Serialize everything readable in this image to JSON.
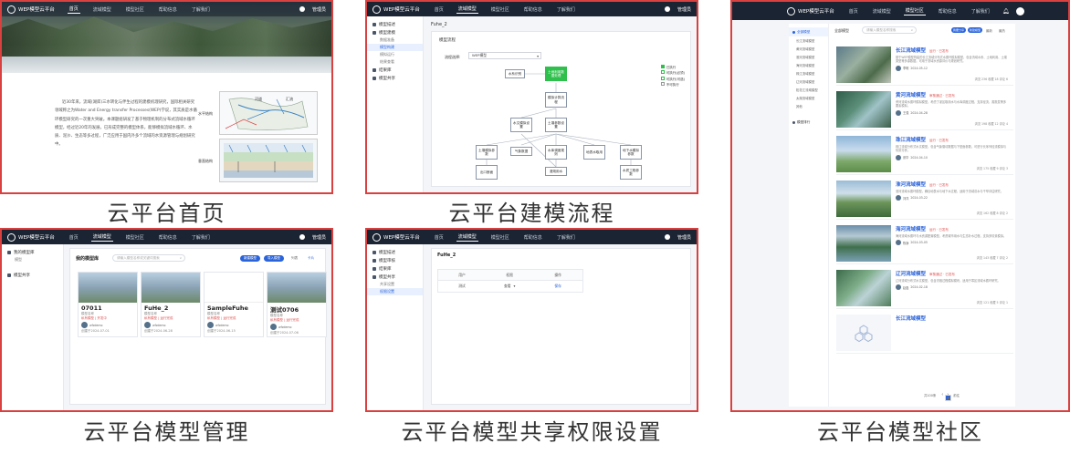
{
  "captions": {
    "p1": "云平台首页",
    "p2": "云平台建模流程",
    "p3": "云平台模型管理",
    "p4": "云平台模型共享权限设置",
    "p5": "云平台模型社区"
  },
  "nav": {
    "logo": "WEP模型云平台",
    "logo_sub": "WEP model cloud platform",
    "items": [
      "首页",
      "流域模型",
      "模型社区",
      "帮助信息",
      "了解我们"
    ],
    "user": "管理员"
  },
  "home": {
    "intro": "近30年来，流域(湖库)三水转化与伴生过程的建模机理研究，国际相关研究领域称之为Water and Energy transfer Processes(WEP)学说，其实质是水循环模型研究的一次重大突破。本课题组研发了基于物理机制的分布式流域水循环模型，经过近20年的发展，已形成完整的模型体系，能够模拟流域水循环、水质、泥沙、生态等多过程，广泛应用于国内外多个流域的水资源管理与规划研究中。",
    "label_a": "水平结构",
    "label_b": "垂直结构",
    "map_label_a": "河道",
    "map_label_b": "汇流"
  },
  "flow": {
    "project": "Fuhe_2",
    "side": {
      "group1": "模型描述",
      "group2": "模型建模",
      "subs": [
        "数据准备",
        "模型构建",
        "模拟运行",
        "结果查看"
      ],
      "group3": "结果库",
      "group4": "模型共享"
    },
    "toolbar_title": "模型流程",
    "select_label": "流程选择:",
    "select_value": "WEP模型",
    "legend": [
      "已执行",
      "可执行(必须)",
      "可执行(可选)",
      "不可执行"
    ],
    "nodes": {
      "n1": "水系识别",
      "n2": "土地利用数据处理",
      "n3": "模拟计算流程",
      "n4": "水文模拟设置",
      "n5": "土壤参数设置",
      "n6": "土壤模拟参数",
      "n7": "气象数据",
      "n8": "水库调度规则",
      "n9": "地表水取用",
      "n10": "地下水模拟参数",
      "n11": "出口断面",
      "n12": "灌溉用水",
      "n13": "水质工程参数"
    }
  },
  "manage": {
    "side_items": [
      "我的模型库",
      "模型",
      "模型共享"
    ],
    "title": "我的模型库",
    "search_placeholder": "请输入模型名称或关键词搜索",
    "btn_new": "新建模型",
    "btn_import": "导入模型",
    "view_list": "列表",
    "view_card": "卡片",
    "cards": [
      {
        "name": "07011",
        "sub": "模型名称",
        "tag": "私有模型 | 开发中",
        "author": "wfzdemo",
        "time": "创建于2024-07-01"
      },
      {
        "name": "FuHe_2",
        "sub": "模型名称",
        "tag": "私有模型 | 运行完成",
        "author": "wfzdemo",
        "time": "创建于2024-06-28"
      },
      {
        "name": "SampleFuhe",
        "sub": "模型名称",
        "tag": "私有模型 | 运行完成",
        "author": "wfzdemo",
        "time": "创建于2024-06-15"
      },
      {
        "name": "测试0706",
        "sub": "模型名称",
        "tag": "私有模型 | 运行完成",
        "author": "wfzdemo",
        "time": "创建于2024-07-06"
      }
    ]
  },
  "share": {
    "project": "FuHe_2",
    "side": {
      "group1": "模型描述",
      "group2": "模型审核",
      "group3": "结果库",
      "group4": "模型共享",
      "subs": [
        "共享设置",
        "权限设置"
      ]
    },
    "table_head": [
      "用户",
      "权限",
      "操作"
    ],
    "row": [
      "测试",
      "查看",
      "保存"
    ]
  },
  "community": {
    "side_title": "全部模型",
    "side_items": [
      "长江流域模型",
      "黄河流域模型",
      "淮河流域模型",
      "海河流域模型",
      "珠江流域模型",
      "辽河流域模型",
      "松花江流域模型",
      "太湖流域模型",
      "其他"
    ],
    "side_bottom": "模型排行",
    "search_placeholder": "请输入模型名称搜索",
    "btn_share": "我要分享",
    "btn_new": "新建模型",
    "sort_a": "最新",
    "sort_b": "最热",
    "items": [
      {
        "title": "长江流域模型",
        "badge": "运行 · 已发布",
        "desc": "基于WEP模型构建的长江流域分布式水循环模拟模型，包含流域水系、土地利用、土壤类型等多源数据，可用于流域水资源评价与规划研究。",
        "author": "李明",
        "time": "2024-05-12",
        "stats": "浏览 236  收藏 18  评论 6"
      },
      {
        "title": "黄河流域模型",
        "badge": "审核通过 · 已发布",
        "desc": "黄河流域水循环模拟模型，考虑了灌区取用水与水库调度过程，支持径流、蒸散发等多要素模拟。",
        "author": "王强",
        "time": "2024-04-28",
        "stats": "浏览 198  收藏 12  评论 4"
      },
      {
        "title": "珠江流域模型",
        "badge": "运行 · 已发布",
        "desc": "珠江流域分布式水文模型，包含气象驱动数据与下垫面参数，可进行长序列径流模拟与情景分析。",
        "author": "张华",
        "time": "2024-04-10",
        "stats": "浏览 175  收藏 9  评论 3"
      },
      {
        "title": "淮河流域模型",
        "badge": "运行 · 已发布",
        "desc": "淮河流域水循环模型，耦合地表水与地下水过程，适用于流域洪水与干旱评估研究。",
        "author": "刘洋",
        "time": "2024-03-22",
        "stats": "浏览 162  收藏 8  评论 2"
      },
      {
        "title": "海河流域模型",
        "badge": "运行 · 已发布",
        "desc": "海河流域水循环与水资源配置模型，考虑城市用水与生态补水过程，支持多情景模拟。",
        "author": "陈静",
        "time": "2024-03-05",
        "stats": "浏览 143  收藏 7  评论 2"
      },
      {
        "title": "辽河流域模型",
        "badge": "审核通过 · 已发布",
        "desc": "辽河流域分布式水文模型，包含冻融过程模拟模块，适用于寒区流域水循环研究。",
        "author": "赵磊",
        "time": "2024-02-18",
        "stats": "浏览 121  收藏 5  评论 1"
      },
      {
        "title": "长江流域模型",
        "badge": "",
        "desc": "",
        "author": "",
        "time": "",
        "stats": ""
      }
    ],
    "pager": {
      "total": "共100条",
      "pages": [
        "1",
        "2",
        "3",
        "4",
        "5",
        "...",
        "10"
      ],
      "next": "下一页",
      "jump": "前往"
    }
  }
}
